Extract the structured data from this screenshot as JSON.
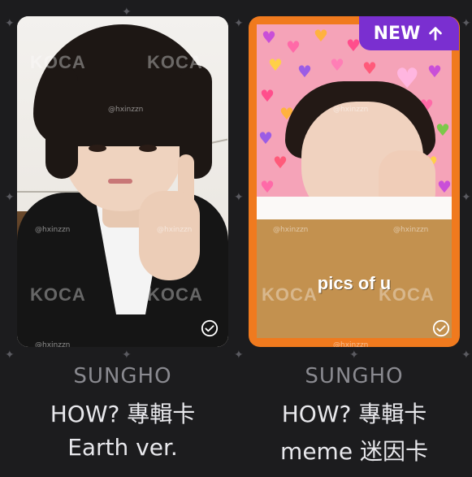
{
  "badge": {
    "label": "NEW",
    "icon": "arrow-up-icon",
    "color": "#7a2fd0"
  },
  "watermarks": {
    "logo": "KOCA",
    "handle": "@hxinzzn"
  },
  "cards": [
    {
      "member": "SUNGHO",
      "title": "HOW? 專輯卡",
      "version": "Earth ver.",
      "image": "photocard-sungho-earth",
      "checked": true
    },
    {
      "member": "SUNGHO",
      "title": "HOW? 專輯卡",
      "version": "meme 迷因卡",
      "image": "photocard-sungho-meme",
      "caption": "pics of u",
      "checked": true
    }
  ],
  "colors": {
    "background": "#1c1c1e",
    "card_border_right": "#f07a1e",
    "member_text": "#8a8a90",
    "title_text": "#e8e8ec"
  }
}
